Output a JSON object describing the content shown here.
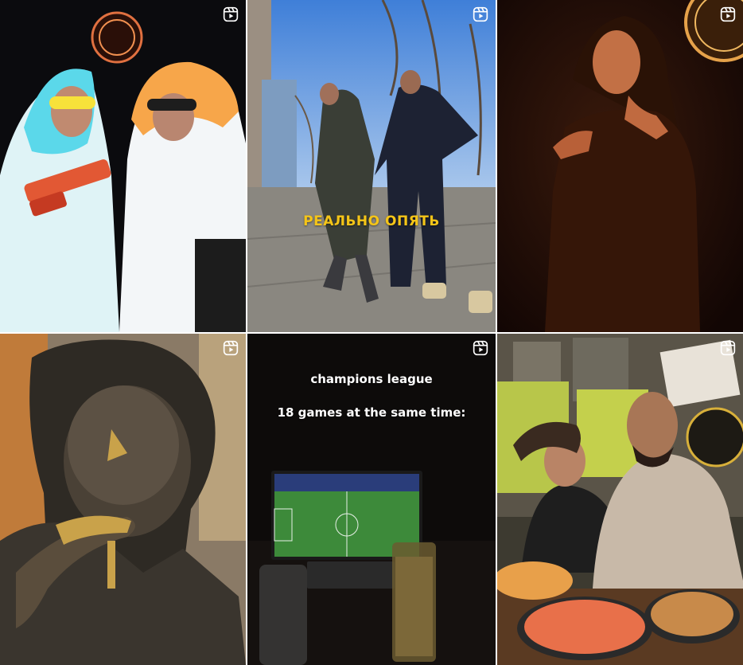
{
  "grid": {
    "columns": 3,
    "rows": 2,
    "tiles": [
      {
        "type": "reel",
        "icon": "reel-icon",
        "caption": ""
      },
      {
        "type": "reel",
        "icon": "reel-icon",
        "caption": "РЕАЛЬНО ОПЯТЬ"
      },
      {
        "type": "reel",
        "icon": "reel-icon",
        "caption": ""
      },
      {
        "type": "reel",
        "icon": "reel-icon",
        "caption": ""
      },
      {
        "type": "reel",
        "icon": "reel-icon",
        "caption_line1": "champions league",
        "caption_line2": "18 games at the same time:"
      },
      {
        "type": "reel",
        "icon": "reel-icon",
        "caption": ""
      }
    ]
  },
  "colors": {
    "caption_yellow": "#f5c518",
    "overlay_white": "#ffffff"
  }
}
